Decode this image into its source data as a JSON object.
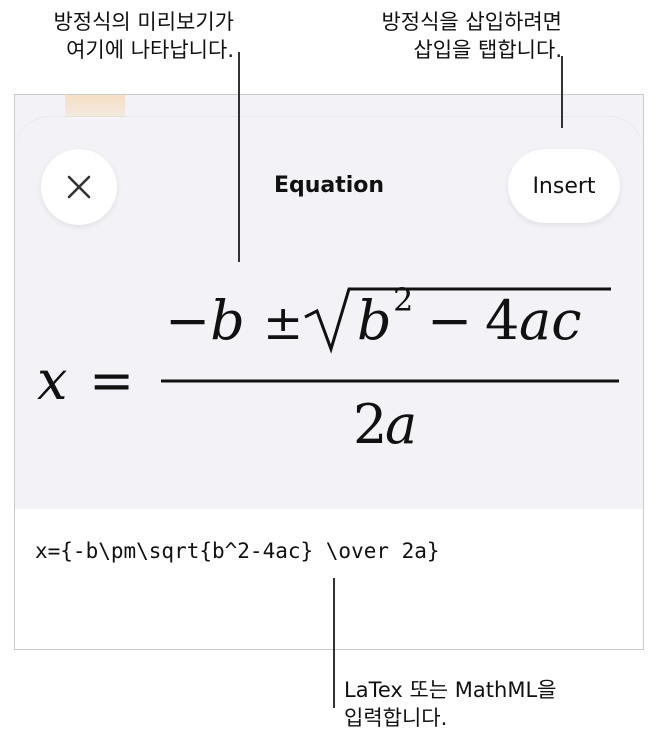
{
  "callouts": {
    "preview_line1": "방정식의 미리보기가",
    "preview_line2": "여기에 나타납니다.",
    "insert_line1": "방정식을 삽입하려면",
    "insert_line2": "삽입을 탭합니다.",
    "input_line1": "LaTex 또는 MathML을",
    "input_line2": "입력합니다."
  },
  "sheet": {
    "title": "Equation",
    "insert_label": "Insert",
    "close_icon": "close-icon"
  },
  "equation_preview": {
    "lhs": "x",
    "equals": "=",
    "num_neg_b": "−b",
    "num_pm": "±",
    "num_b": "b",
    "num_exp": "2",
    "num_minus": "−",
    "num_4": "4",
    "num_ac": "ac",
    "den_2": "2",
    "den_a": "a"
  },
  "editor": {
    "latex": "x={-b\\pm\\sqrt{b^2-4ac} \\over 2a}"
  }
}
